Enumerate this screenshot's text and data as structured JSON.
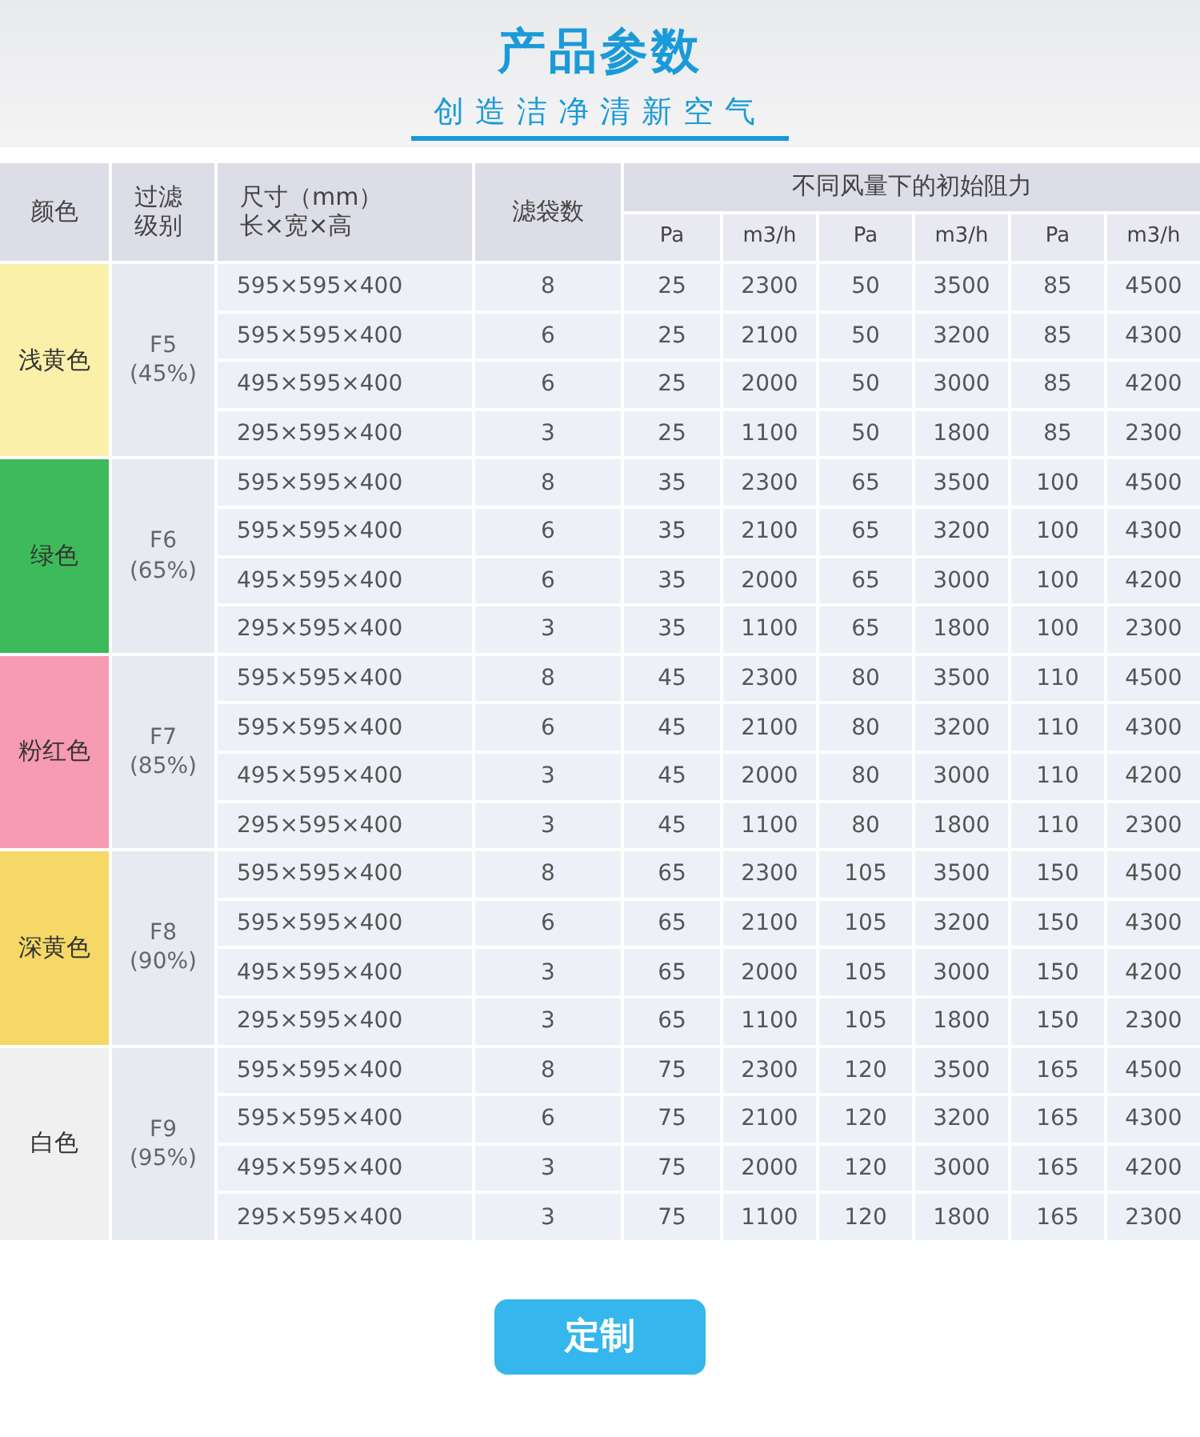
{
  "header": {
    "title": "产品参数",
    "subtitle": "创造洁净清新空气"
  },
  "table": {
    "columns": [
      [
        "颜色"
      ],
      [
        "过滤",
        "级别"
      ],
      [
        "尺寸（mm）",
        "长×宽×高"
      ],
      [
        "滤袋数"
      ]
    ],
    "group_heading": "不同风量下的初始阻力",
    "sub_columns": [
      "Pa",
      "m3/h",
      "Pa",
      "m3/h",
      "Pa",
      "m3/h"
    ],
    "groups": [
      {
        "color_name": "浅黄色",
        "color": "#fbf0aa",
        "grade": "F5",
        "efficiency": "(45%)",
        "rows": [
          {
            "size": "595×595×400",
            "bags": "8",
            "values": [
              "25",
              "2300",
              "50",
              "3500",
              "85",
              "4500"
            ]
          },
          {
            "size": "595×595×400",
            "bags": "6",
            "values": [
              "25",
              "2100",
              "50",
              "3200",
              "85",
              "4300"
            ]
          },
          {
            "size": "495×595×400",
            "bags": "6",
            "values": [
              "25",
              "2000",
              "50",
              "3000",
              "85",
              "4200"
            ]
          },
          {
            "size": "295×595×400",
            "bags": "3",
            "values": [
              "25",
              "1100",
              "50",
              "1800",
              "85",
              "2300"
            ]
          }
        ]
      },
      {
        "color_name": "绿色",
        "color": "#3dbb5a",
        "grade": "F6",
        "efficiency": "(65%)",
        "rows": [
          {
            "size": "595×595×400",
            "bags": "8",
            "values": [
              "35",
              "2300",
              "65",
              "3500",
              "100",
              "4500"
            ]
          },
          {
            "size": "595×595×400",
            "bags": "6",
            "values": [
              "35",
              "2100",
              "65",
              "3200",
              "100",
              "4300"
            ]
          },
          {
            "size": "495×595×400",
            "bags": "6",
            "values": [
              "35",
              "2000",
              "65",
              "3000",
              "100",
              "4200"
            ]
          },
          {
            "size": "295×595×400",
            "bags": "3",
            "values": [
              "35",
              "1100",
              "65",
              "1800",
              "100",
              "2300"
            ]
          }
        ]
      },
      {
        "color_name": "粉红色",
        "color": "#f79bb2",
        "grade": "F7",
        "efficiency": "(85%)",
        "rows": [
          {
            "size": "595×595×400",
            "bags": "8",
            "values": [
              "45",
              "2300",
              "80",
              "3500",
              "110",
              "4500"
            ]
          },
          {
            "size": "595×595×400",
            "bags": "6",
            "values": [
              "45",
              "2100",
              "80",
              "3200",
              "110",
              "4300"
            ]
          },
          {
            "size": "495×595×400",
            "bags": "3",
            "values": [
              "45",
              "2000",
              "80",
              "3000",
              "110",
              "4200"
            ]
          },
          {
            "size": "295×595×400",
            "bags": "3",
            "values": [
              "45",
              "1100",
              "80",
              "1800",
              "110",
              "2300"
            ]
          }
        ]
      },
      {
        "color_name": "深黄色",
        "color": "#f5d865",
        "grade": "F8",
        "efficiency": "(90%)",
        "rows": [
          {
            "size": "595×595×400",
            "bags": "8",
            "values": [
              "65",
              "2300",
              "105",
              "3500",
              "150",
              "4500"
            ]
          },
          {
            "size": "595×595×400",
            "bags": "6",
            "values": [
              "65",
              "2100",
              "105",
              "3200",
              "150",
              "4300"
            ]
          },
          {
            "size": "495×595×400",
            "bags": "3",
            "values": [
              "65",
              "2000",
              "105",
              "3000",
              "150",
              "4200"
            ]
          },
          {
            "size": "295×595×400",
            "bags": "3",
            "values": [
              "65",
              "1100",
              "105",
              "1800",
              "150",
              "2300"
            ]
          }
        ]
      },
      {
        "color_name": "白色",
        "color": "#f0f0f0",
        "grade": "F9",
        "efficiency": "(95%)",
        "rows": [
          {
            "size": "595×595×400",
            "bags": "8",
            "values": [
              "75",
              "2300",
              "120",
              "3500",
              "165",
              "4500"
            ]
          },
          {
            "size": "595×595×400",
            "bags": "6",
            "values": [
              "75",
              "2100",
              "120",
              "3200",
              "165",
              "4300"
            ]
          },
          {
            "size": "495×595×400",
            "bags": "3",
            "values": [
              "75",
              "2000",
              "120",
              "3000",
              "165",
              "4200"
            ]
          },
          {
            "size": "295×595×400",
            "bags": "3",
            "values": [
              "75",
              "1100",
              "120",
              "1800",
              "165",
              "2300"
            ]
          }
        ]
      }
    ]
  },
  "button": "定制"
}
